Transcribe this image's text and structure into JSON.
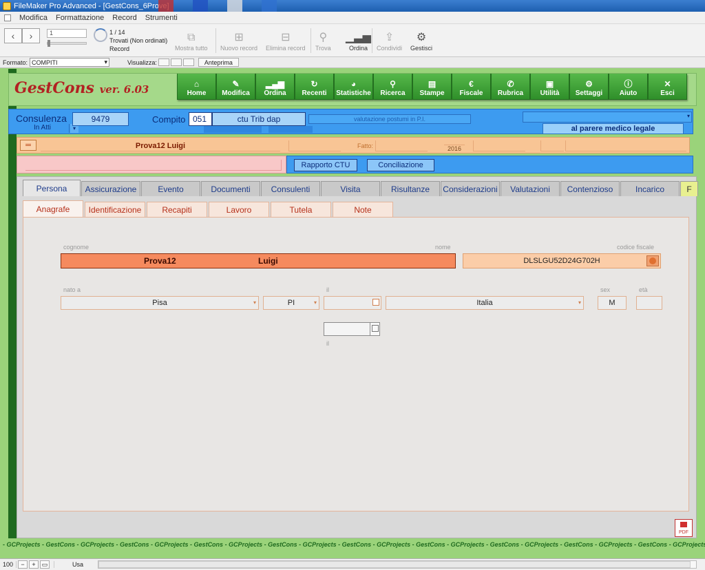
{
  "window": {
    "title": "FileMaker Pro Advanced - [GestCons_6Prove]"
  },
  "menu": [
    "Modifica",
    "Formattazione",
    "Record",
    "Strumenti"
  ],
  "toolbar": {
    "record_field": "1",
    "record_count": "1 / 14",
    "found_status": "Trovati (Non ordinati)",
    "record_label": "Record",
    "tools": [
      {
        "label": "Mostra tutto",
        "icon": "show-all-icon"
      },
      {
        "label": "Nuovo record",
        "icon": "new-record-icon"
      },
      {
        "label": "Elimina record",
        "icon": "delete-record-icon"
      },
      {
        "label": "Trova",
        "icon": "search-icon"
      },
      {
        "label": "Ordina",
        "icon": "sort-icon"
      },
      {
        "label": "Condividi",
        "icon": "share-icon"
      },
      {
        "label": "Gestisci",
        "icon": "gear-icon"
      }
    ]
  },
  "layoutbar": {
    "format_label": "Formato:",
    "format_value": "COMPITI",
    "view_label": "Visualizza:",
    "preview_label": "Anteprima"
  },
  "header": {
    "brand": "GestCons",
    "version": "ver. 6.03",
    "nav": [
      {
        "label": "Home",
        "icon": "home-icon"
      },
      {
        "label": "Modifica",
        "icon": "pencil-icon"
      },
      {
        "label": "Ordina",
        "icon": "bars-icon"
      },
      {
        "label": "Recenti",
        "icon": "refresh-icon"
      },
      {
        "label": "Statistiche",
        "icon": "pie-icon"
      },
      {
        "label": "Ricerca",
        "icon": "search-icon"
      },
      {
        "label": "Stampe",
        "icon": "printer-icon"
      },
      {
        "label": "Fiscale",
        "icon": "euro-icon"
      },
      {
        "label": "Rubrica",
        "icon": "phone-icon"
      },
      {
        "label": "Utilità",
        "icon": "box-icon"
      },
      {
        "label": "Settaggi",
        "icon": "gear-icon"
      },
      {
        "label": "Aiuto",
        "icon": "info-icon"
      },
      {
        "label": "Esci",
        "icon": "close-icon"
      }
    ]
  },
  "record_bar": {
    "consulenza_label": "Consulenza",
    "consulenza_status": "In Atti",
    "consulenza_num": "9479",
    "compito_label": "Compito",
    "compito_code": "051",
    "compito_desc": "ctu Trib dap",
    "valutazione": "valutazione postumi in P.I.",
    "parere": "al parere medico legale"
  },
  "patient_bar": {
    "name": "Prova12  Luigi",
    "fatto_label": "Fatto:",
    "year": "2016"
  },
  "actions": {
    "rapporto": "Rapporto CTU",
    "conciliazione": "Conciliazione"
  },
  "tabs": [
    {
      "label": "Persona",
      "w": 84
    },
    {
      "label": "Assicurazione",
      "w": 86
    },
    {
      "label": "Evento",
      "w": 86
    },
    {
      "label": "Documenti",
      "w": 86
    },
    {
      "label": "Consulenti",
      "w": 86
    },
    {
      "label": "Visita",
      "w": 86
    },
    {
      "label": "Risultanze",
      "w": 86
    },
    {
      "label": "Considerazioni",
      "w": 86
    },
    {
      "label": "Valutazioni",
      "w": 86
    },
    {
      "label": "Contenzioso",
      "w": 86
    },
    {
      "label": "Incarico",
      "w": 86
    },
    {
      "label": "F",
      "w": 26
    }
  ],
  "subtabs": [
    "Anagrafe",
    "Identificazione",
    "Recapiti",
    "Lavoro",
    "Tutela",
    "Note"
  ],
  "anagrafe": {
    "lbl_cognome": "cognome",
    "lbl_nome": "nome",
    "lbl_cf": "codice fiscale",
    "cognome": "Prova12",
    "nome": "Luigi",
    "codice_fiscale": "DLSLGU52D24G702H",
    "lbl_nato": "nato a",
    "lbl_il": "il",
    "lbl_sex": "sex",
    "lbl_eta": "età",
    "luogo": "Pisa",
    "provincia": "PI",
    "nazione": "Italia",
    "sex": "M",
    "lbl_il2": "il"
  },
  "footer": {
    "text": "- GCProjects - GestCons - GCProjects - GestCons - GCProjects - GestCons - GCProjects - GestCons - GCProjects - GestCons - GCProjects - GestCons - GCProjects - GestCons - GCProjects - GestCons - GCProjects - GestCons - GCProjects - GestCons - GCProjects - GestCons - GCProjects - GestCons - GCProjects - GestCons - GCProjects - GestCons - GCProjects - GestCons - GCProjects - GestCons - GCProjects - GestCons - GCProjects -"
  },
  "statusbar": {
    "zoom": "100",
    "mode": "Usa"
  },
  "pdf_label": "PDF"
}
